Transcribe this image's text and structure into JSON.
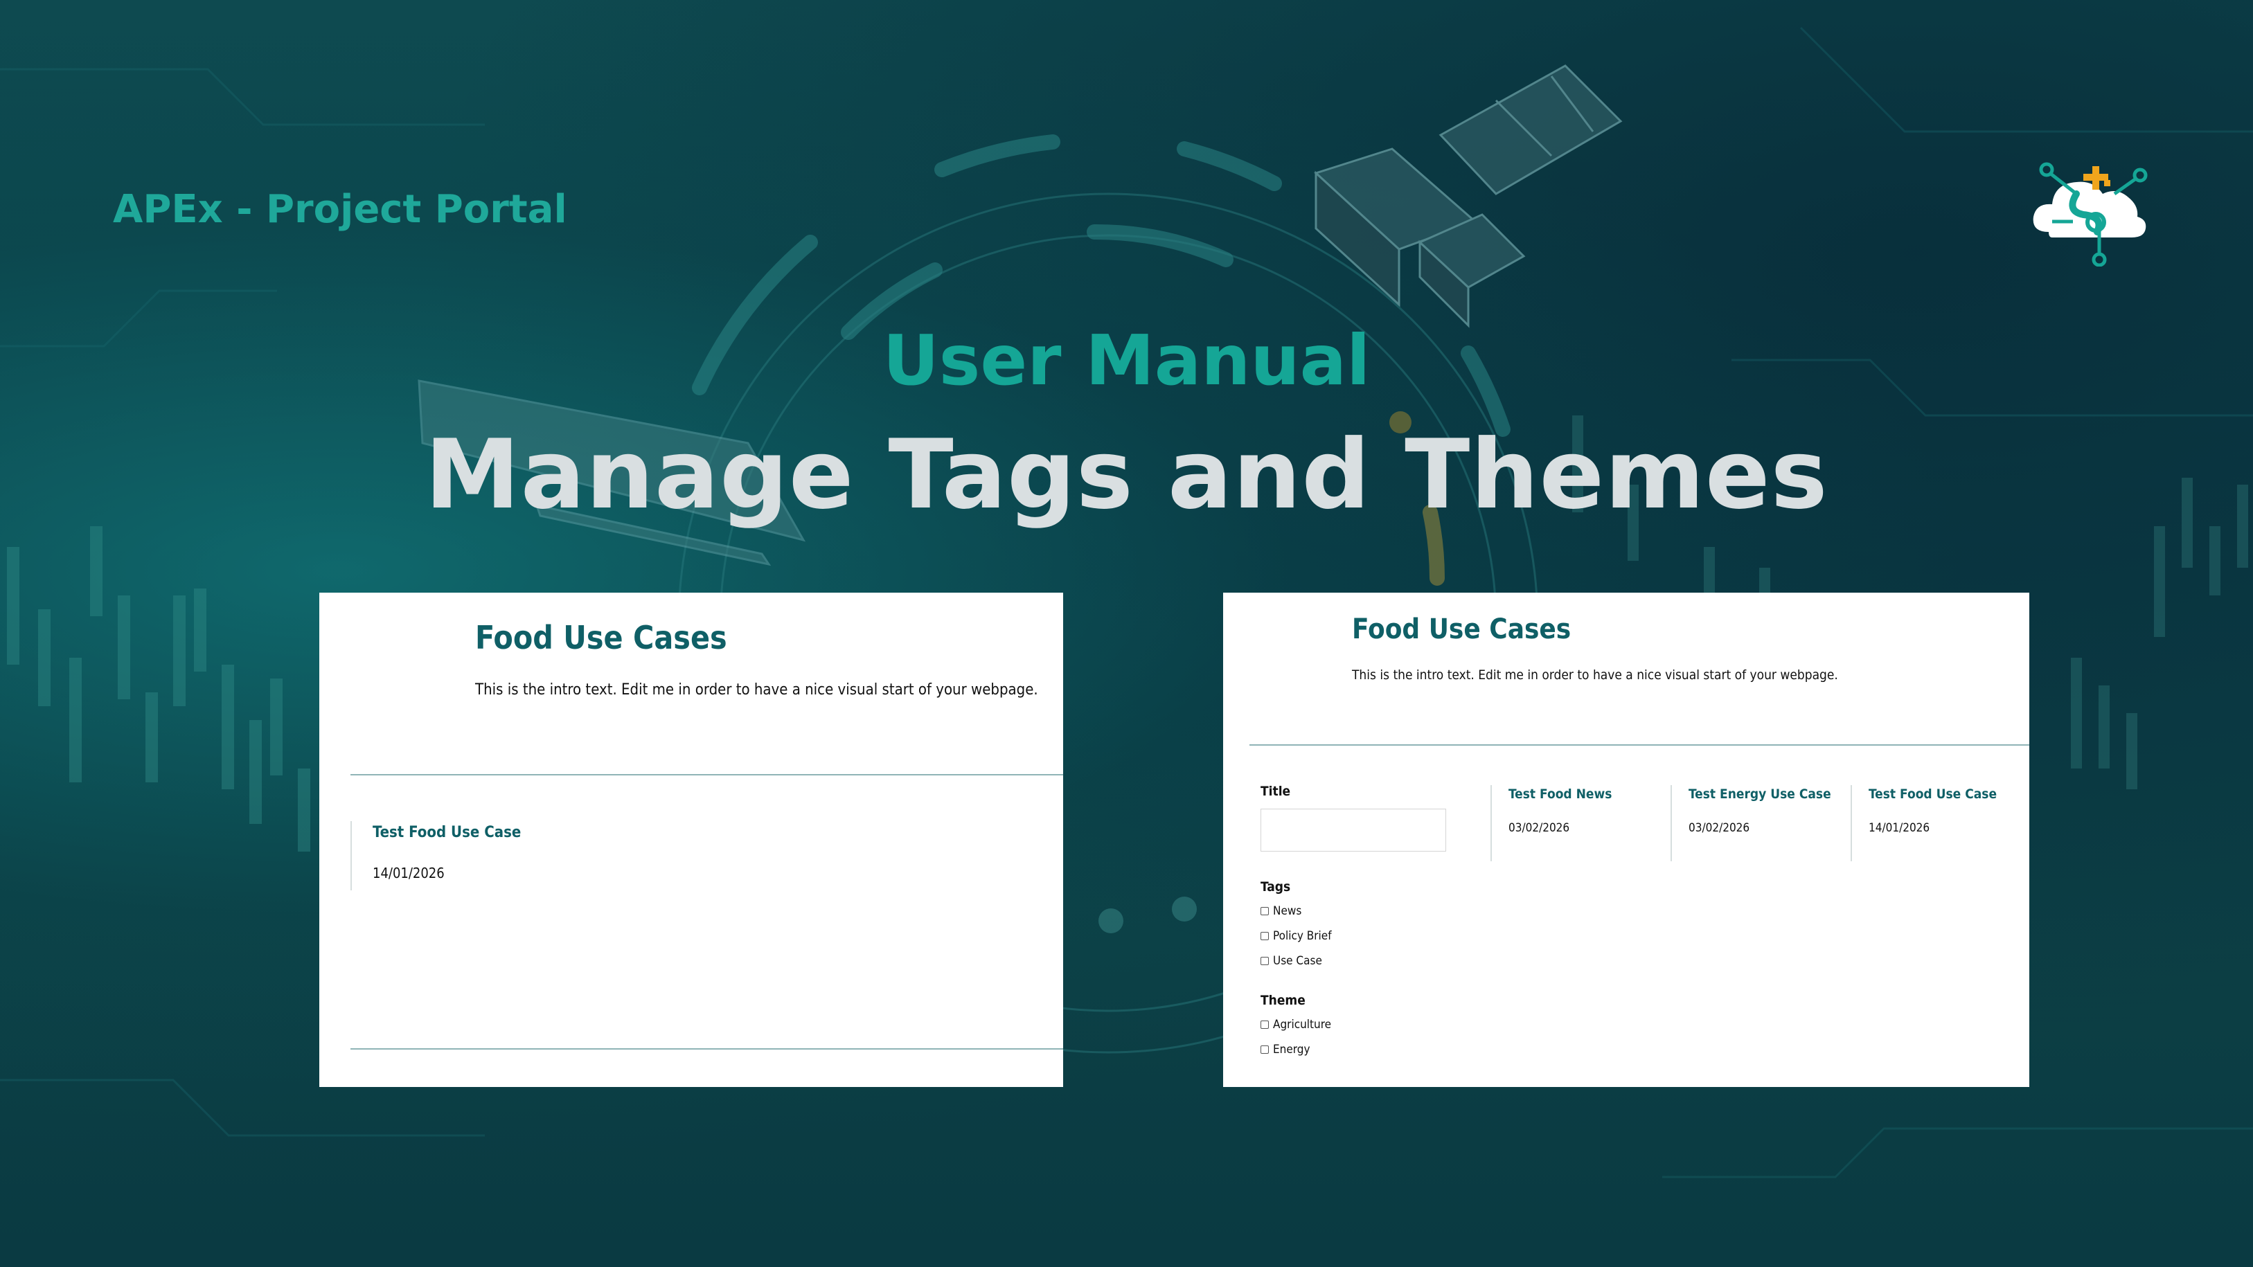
{
  "header": {
    "portal_title": "APEx - Project Portal",
    "subtitle": "User Manual",
    "title": "Manage Tags and Themes",
    "logo_icon": "apex-cloud-logo-icon"
  },
  "colors": {
    "accent": "#15a696",
    "heading_teal": "#0f5f66",
    "background": "#0a3a42",
    "title_text": "#d9dfe1"
  },
  "left_panel": {
    "heading": "Food Use Cases",
    "intro": "This is the intro text. Edit me in order to have a nice visual start of your webpage.",
    "items": [
      {
        "title": "Test Food Use Case",
        "date": "14/01/2026"
      }
    ]
  },
  "right_panel": {
    "heading": "Food Use Cases",
    "intro": "This is the intro text. Edit me in order to have a nice visual start of your webpage.",
    "filters": {
      "title_label": "Title",
      "title_value": "",
      "tags_label": "Tags",
      "tags": [
        "News",
        "Policy Brief",
        "Use Case"
      ],
      "theme_label": "Theme",
      "themes": [
        "Agriculture",
        "Energy"
      ]
    },
    "results": [
      {
        "title": "Test Food News",
        "date": "03/02/2026"
      },
      {
        "title": "Test Energy Use Case",
        "date": "03/02/2026"
      },
      {
        "title": "Test Food Use Case",
        "date": "14/01/2026"
      }
    ]
  }
}
